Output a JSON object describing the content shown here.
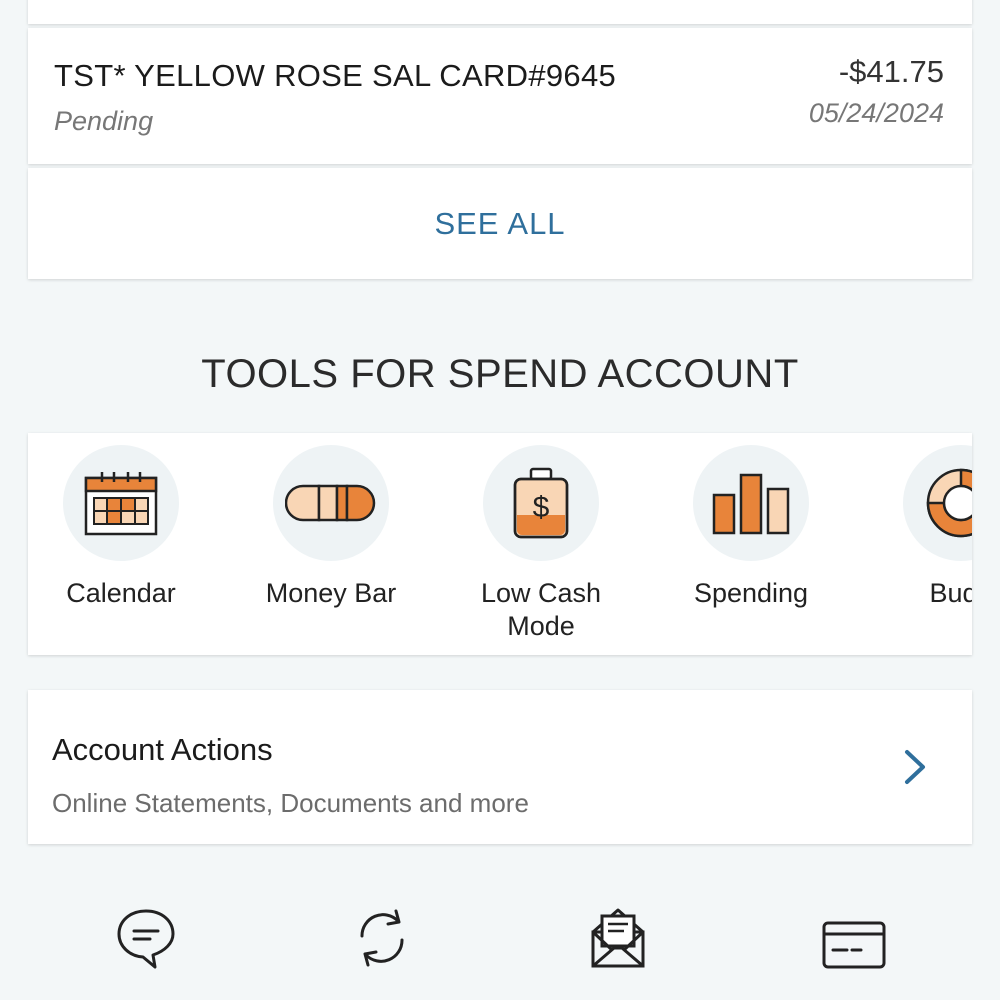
{
  "transaction": {
    "description": "TST* YELLOW ROSE SAL CARD#9645",
    "status": "Pending",
    "amount": "-$41.75",
    "date": "05/24/2024"
  },
  "see_all": {
    "label": "SEE ALL"
  },
  "tools": {
    "title": "TOOLS FOR SPEND ACCOUNT",
    "items": [
      {
        "label": "Calendar",
        "icon": "calendar-icon"
      },
      {
        "label": "Money Bar",
        "icon": "money-bar-icon"
      },
      {
        "label": "Low Cash\nMode",
        "icon": "low-cash-mode-icon"
      },
      {
        "label": "Spending",
        "icon": "spending-icon"
      },
      {
        "label": "Budg",
        "icon": "budget-icon"
      }
    ]
  },
  "account_actions": {
    "title": "Account Actions",
    "subtitle": "Online Statements, Documents and more"
  },
  "bottom_nav": {
    "items": [
      {
        "icon": "help-chat-icon"
      },
      {
        "icon": "transfer-icon"
      },
      {
        "icon": "bill-pay-icon"
      },
      {
        "icon": "cards-icon"
      }
    ]
  },
  "colors": {
    "accent_blue": "#2f6f9c",
    "icon_orange": "#e8843a",
    "icon_light_orange": "#f9d6b5",
    "background": "#f3f7f8"
  }
}
